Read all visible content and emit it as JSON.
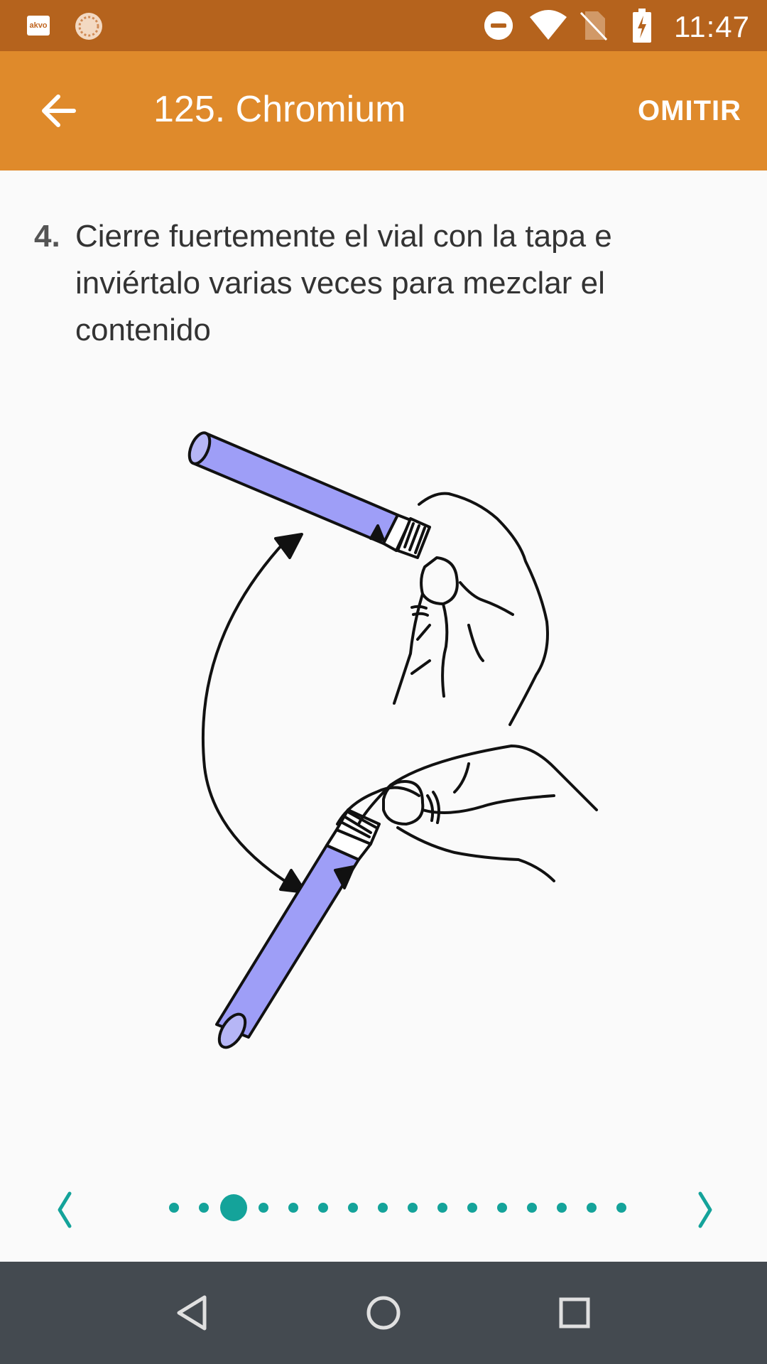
{
  "status_bar": {
    "left_icons": [
      "akvo-icon",
      "sync-icon"
    ],
    "akvo_label": "akvo",
    "right_icons": [
      "do-not-disturb-icon",
      "wifi-icon",
      "no-sim-icon",
      "battery-charging-icon"
    ],
    "time": "11:47"
  },
  "app_bar": {
    "back_icon": "arrow-back-icon",
    "title": "125. Chromium",
    "skip_label": "OMITIR"
  },
  "instruction": {
    "number": "4.",
    "text": "Cierre fuertemente el vial con la tapa e inviértalo varias veces para mezclar el contenido"
  },
  "illustration": {
    "icon": "vial-inversion-illustration"
  },
  "pager": {
    "prev_icon": "chevron-left-icon",
    "next_icon": "chevron-right-icon",
    "total_pages": 16,
    "current_page": 3,
    "accent_color": "#14a39a"
  },
  "nav_bar": {
    "buttons": [
      "back-triangle-icon",
      "home-circle-icon",
      "recents-square-icon"
    ]
  },
  "colors": {
    "status_bar": "#b5631d",
    "app_bar": "#df8a2b",
    "background": "#fafafa",
    "nav_bar": "#444a50",
    "vial_fill": "#9e9ef7"
  }
}
